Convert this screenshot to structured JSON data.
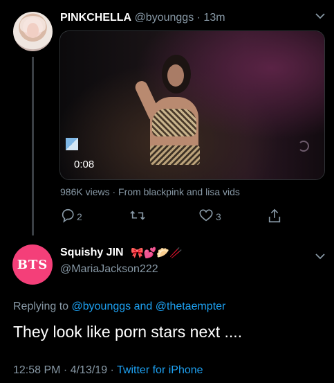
{
  "tweet1": {
    "display_name": "PINKCHELLA",
    "handle": "@byounggs",
    "time": "13m",
    "video": {
      "timestamp": "0:08"
    },
    "views_text": "986K views",
    "source_text": "From blackpink and lisa vids",
    "reply_count": "2",
    "like_count": "3"
  },
  "tweet2": {
    "display_name": "Squishy JIN",
    "emojis": "🎀💕🥟🥢",
    "handle": "@MariaJackson222",
    "avatar_text": "BTS",
    "replying_label": "Replying to",
    "replying_user1": "@byounggs",
    "replying_and": "and",
    "replying_user2": "@thetaempter",
    "text": "They look like porn stars next ....",
    "time": "12:58 PM",
    "date": "4/13/19",
    "client": "Twitter for iPhone"
  },
  "icons": [
    "chevron-down-icon",
    "reply-icon",
    "retweet-icon",
    "like-icon",
    "share-icon"
  ],
  "colors": {
    "background": "#000000",
    "secondary_text": "#8899a6",
    "link_blue": "#1da1f2",
    "bts_pink": "#f43f79",
    "divider": "#2f3336"
  }
}
